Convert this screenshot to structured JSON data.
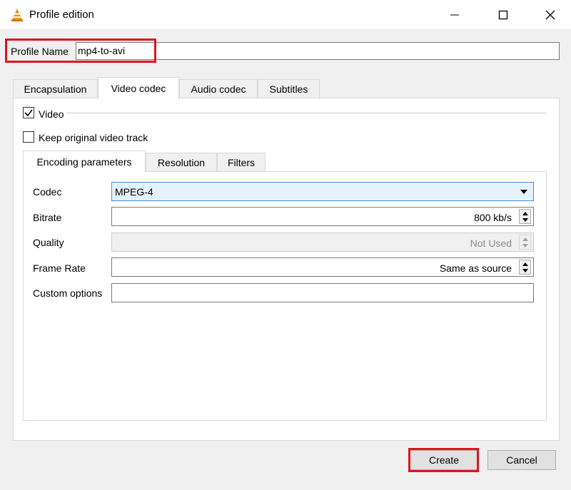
{
  "window": {
    "title": "Profile edition",
    "icon": "vlc-cone-icon"
  },
  "profile": {
    "label": "Profile Name",
    "value": "mp4-to-avi"
  },
  "tabs": [
    {
      "label": "Encapsulation",
      "active": false
    },
    {
      "label": "Video codec",
      "active": true
    },
    {
      "label": "Audio codec",
      "active": false
    },
    {
      "label": "Subtitles",
      "active": false
    }
  ],
  "video": {
    "enabled_label": "Video",
    "enabled": true,
    "keep_label": "Keep original video track",
    "keep": false
  },
  "inner_tabs": [
    {
      "label": "Encoding parameters",
      "active": true
    },
    {
      "label": "Resolution",
      "active": false
    },
    {
      "label": "Filters",
      "active": false
    }
  ],
  "form": {
    "codec": {
      "label": "Codec",
      "value": "MPEG-4"
    },
    "bitrate": {
      "label": "Bitrate",
      "value": "800 kb/s"
    },
    "quality": {
      "label": "Quality",
      "value": "Not Used"
    },
    "frame_rate": {
      "label": "Frame Rate",
      "value": "Same as source"
    },
    "custom": {
      "label": "Custom options",
      "value": ""
    }
  },
  "buttons": {
    "create": "Create",
    "cancel": "Cancel"
  },
  "colors": {
    "highlight": "#e0141d",
    "focus": "#3c8fe0"
  }
}
